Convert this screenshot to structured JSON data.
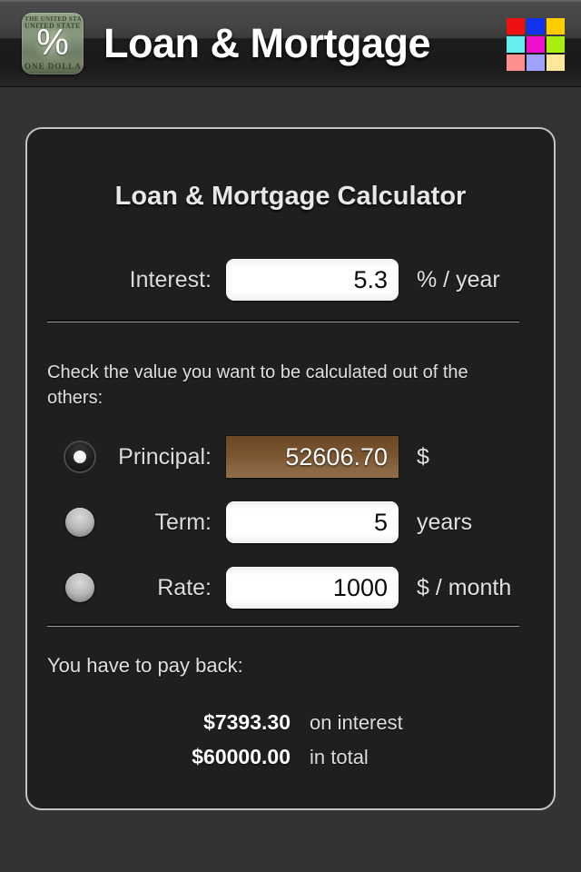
{
  "header": {
    "title": "Loan & Mortgage",
    "app_icon": {
      "name": "dollar-bill-percent-icon",
      "symbol": "%",
      "bill_text_top": "THE UNITED STATES OF AMERICA",
      "bill_text_mid": "UNITED STATES OF AMERICA",
      "bill_text_bottom": "ONE DOLLAR"
    },
    "color_grid": {
      "name": "color-palette-grid",
      "colors": [
        "#ee1111",
        "#1133ee",
        "#ffcc00",
        "#66eeee",
        "#ee11cc",
        "#aaee11",
        "#ff8f8f",
        "#a0a0ff",
        "#ffe79a"
      ]
    }
  },
  "card": {
    "title": "Loan & Mortgage Calculator",
    "interest": {
      "label": "Interest:",
      "value": "5.3",
      "placeholder": "",
      "unit": "% / year"
    },
    "hint": "Check the value you want to be calculated out of the others:",
    "options": [
      {
        "id": "principal",
        "label": "Principal:",
        "value": "52606.70",
        "placeholder": "",
        "unit": "$",
        "selected": true
      },
      {
        "id": "term",
        "label": "Term:",
        "value": "5",
        "placeholder": "",
        "unit": "years",
        "selected": false
      },
      {
        "id": "rate",
        "label": "Rate:",
        "value": "1000",
        "placeholder": "",
        "unit": "$ / month",
        "selected": false
      }
    ],
    "results": {
      "intro": "You have to pay back:",
      "rows": [
        {
          "amount": "$7393.30",
          "desc": "on interest"
        },
        {
          "amount": "$60000.00",
          "desc": "in total"
        }
      ]
    }
  },
  "colors": {
    "page_background": "#333333",
    "card_background": "#1f1f1f",
    "card_border": "#c3c3c3",
    "highlight_field": "#7b5530",
    "text_primary": "#e8e8e8"
  }
}
